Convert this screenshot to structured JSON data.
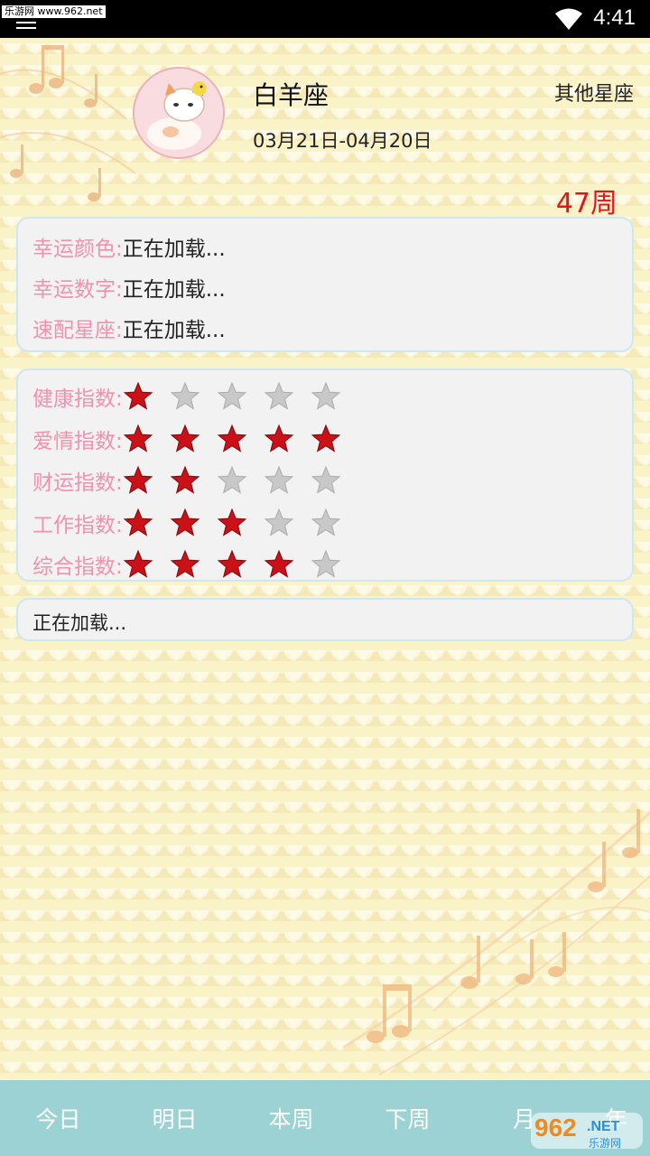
{
  "status_bar": {
    "watermark": "乐游网 www.962.net",
    "time": "4:41"
  },
  "header": {
    "sign_name": "白羊座",
    "date_range": "03月21日-04月20日",
    "other_signs_link": "其他星座",
    "week_label": "47周"
  },
  "lucky_info": {
    "rows": [
      {
        "label": "幸运颜色:",
        "value": "正在加载..."
      },
      {
        "label": "幸运数字:",
        "value": "正在加载..."
      },
      {
        "label": "速配星座:",
        "value": "正在加载..."
      }
    ]
  },
  "indices": {
    "max_stars": 5,
    "active_color": "#cc1018",
    "inactive_color": "#c8c8c8",
    "rows": [
      {
        "label": "健康指数:",
        "stars": 1
      },
      {
        "label": "爱情指数:",
        "stars": 5
      },
      {
        "label": "财运指数:",
        "stars": 2
      },
      {
        "label": "工作指数:",
        "stars": 3
      },
      {
        "label": "综合指数:",
        "stars": 4
      }
    ]
  },
  "summary": {
    "text": "正在加载..."
  },
  "bottom_nav": {
    "items": [
      "今日",
      "明日",
      "本周",
      "下周",
      "月",
      "年"
    ]
  },
  "watermark_logo": {
    "brand": "962",
    "suffix": ".NET",
    "caption": "乐游网"
  },
  "colors": {
    "label_pink": "#f192ad",
    "week_red": "#e0161d",
    "nav_bg": "#9cd2d4",
    "card_border": "#cde8f4"
  }
}
